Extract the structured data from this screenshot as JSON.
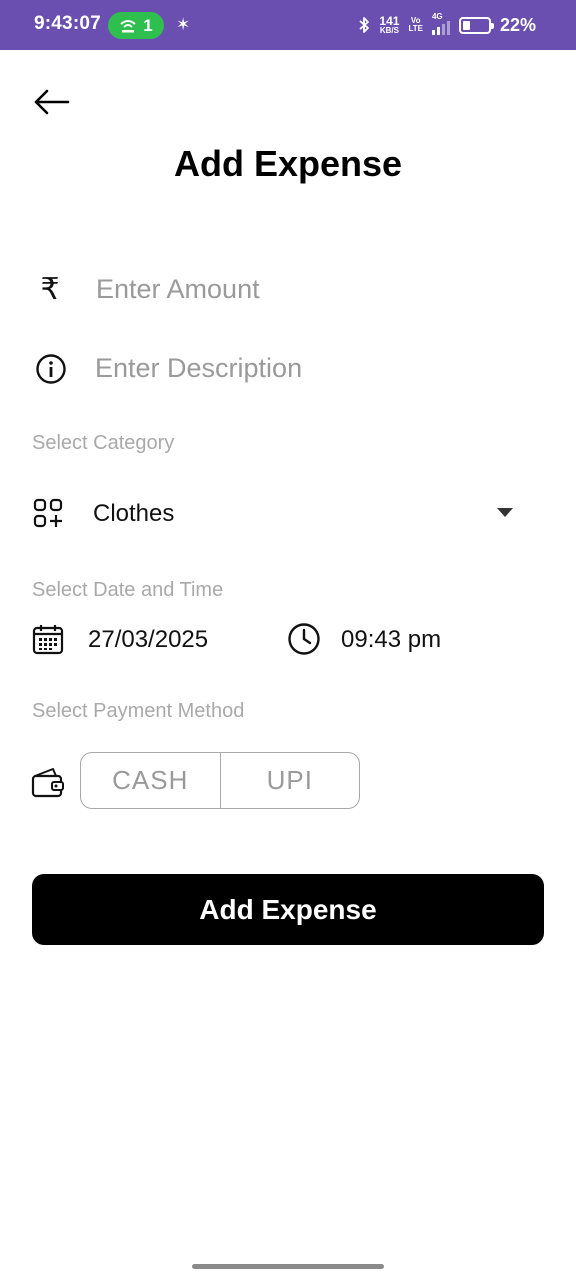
{
  "status_bar": {
    "time": "9:43:07",
    "hotspot_count": "1",
    "spark_icon": "✶",
    "bluetooth_icon": "bluetooth-icon",
    "net_speed_value": "141",
    "net_speed_unit": "KB/S",
    "volte_top": "Vo",
    "volte_bottom": "LTE",
    "network_type": "4G",
    "battery_percent": "22%",
    "background_color": "#6a4fb0",
    "hotspot_color": "#2fbf4f"
  },
  "header": {
    "back_icon": "arrow-left-icon",
    "title": "Add Expense"
  },
  "form": {
    "amount": {
      "icon": "rupee-icon",
      "symbol": "₹",
      "placeholder": "Enter Amount",
      "value": ""
    },
    "description": {
      "icon": "info-icon",
      "placeholder": "Enter Description",
      "value": ""
    },
    "category": {
      "label": "Select Category",
      "icon": "category-grid-icon",
      "selected": "Clothes"
    },
    "datetime": {
      "label": "Select Date and Time",
      "date": "27/03/2025",
      "time": "09:43 pm"
    },
    "payment": {
      "label": "Select Payment Method",
      "icon": "wallet-icon",
      "options": [
        "CASH",
        "UPI"
      ]
    }
  },
  "submit": {
    "label": "Add Expense"
  }
}
